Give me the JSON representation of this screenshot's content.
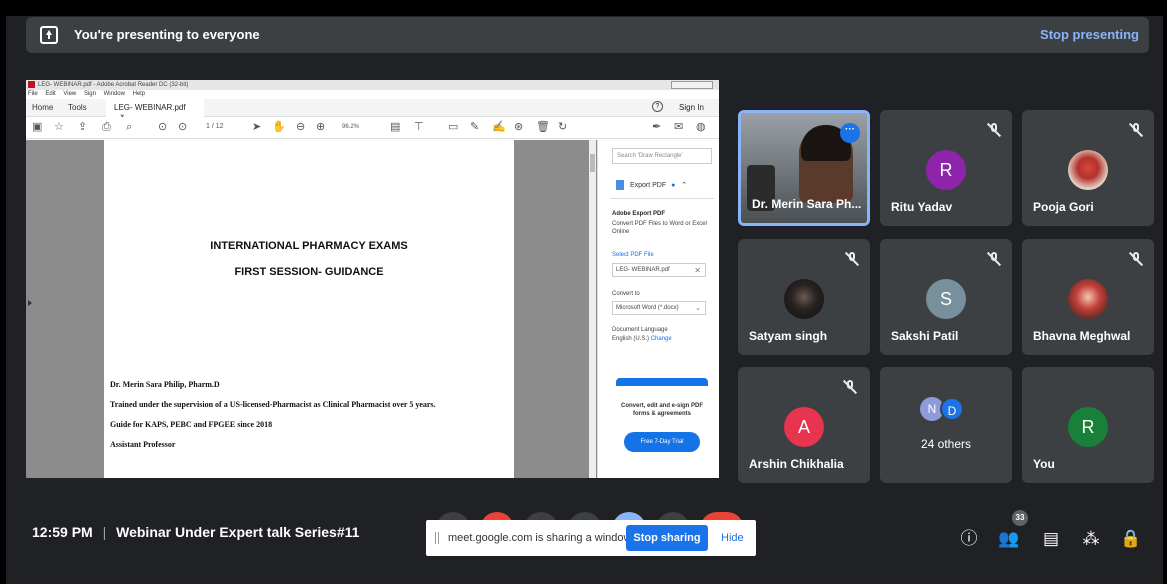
{
  "banner": {
    "text": "You're presenting to everyone",
    "stop_label": "Stop presenting"
  },
  "shared_window": {
    "title": "LEG- WEBINAR.pdf - Adobe Acrobat Reader DC (32-bit)",
    "menu": [
      "File",
      "Edit",
      "View",
      "Sign",
      "Window",
      "Help"
    ],
    "tabs": {
      "home": "Home",
      "tools": "Tools",
      "document": "LEG- WEBINAR.pdf",
      "close": "×",
      "help": "?",
      "sign_in": "Sign In"
    },
    "toolbar": {
      "page_current": "1",
      "page_total": "/ 12",
      "zoom": "96.2%"
    },
    "pdf": {
      "heading1": "INTERNATIONAL PHARMACY EXAMS",
      "heading2": "FIRST SESSION-  GUIDANCE",
      "lines": [
        "Dr. Merin Sara Philip, Pharm.D",
        "Trained under the supervision of a US-licensed-Pharmacist as Clinical Pharmacist over 5 years.",
        "Guide for KAPS, PEBC and FPGEE since 2018",
        "Assistant Professor"
      ]
    },
    "right_pane": {
      "search_placeholder": "Search 'Draw Rectangle'",
      "export_label": "Export PDF",
      "section_title": "Adobe Export PDF",
      "description": "Convert PDF Files to Word or Excel Online",
      "select_label": "Select PDF File",
      "file_name": "LEG- WEBINAR.pdf",
      "convert_label": "Convert to",
      "convert_value": "Microsoft Word (*.docx)",
      "language_label": "Document Language",
      "language_value": "English (U.S.)",
      "change_link": "Change",
      "promo": "Convert, edit and e-sign PDF forms & agreements",
      "trial_button": "Free 7-Day Trial"
    }
  },
  "participants": [
    {
      "name": "Dr. Merin Sara Ph...",
      "type": "video"
    },
    {
      "name": "Ritu Yadav",
      "initial": "R",
      "color": "#8e24aa",
      "muted": true
    },
    {
      "name": "Pooja Gori",
      "type": "photo",
      "muted": true
    },
    {
      "name": "Satyam singh",
      "type": "photo",
      "muted": true
    },
    {
      "name": "Sakshi Patil",
      "initial": "S",
      "color": "#78909c",
      "muted": true
    },
    {
      "name": "Bhavna Meghwal",
      "type": "photo",
      "muted": true
    },
    {
      "name": "Arshin Chikhalia",
      "initial": "A",
      "color": "#e8344e",
      "muted": true
    },
    {
      "name": "24 others",
      "initials": [
        "N",
        "D"
      ]
    },
    {
      "name": "You",
      "initial": "R",
      "color": "#188038"
    }
  ],
  "bottom_bar": {
    "time": "12:59 PM",
    "separator": "|",
    "meeting_title": "Webinar Under Expert talk Series#11",
    "share_message": "meet.google.com is sharing a window.",
    "stop_sharing": "Stop sharing",
    "hide": "Hide",
    "participant_count": "33"
  }
}
